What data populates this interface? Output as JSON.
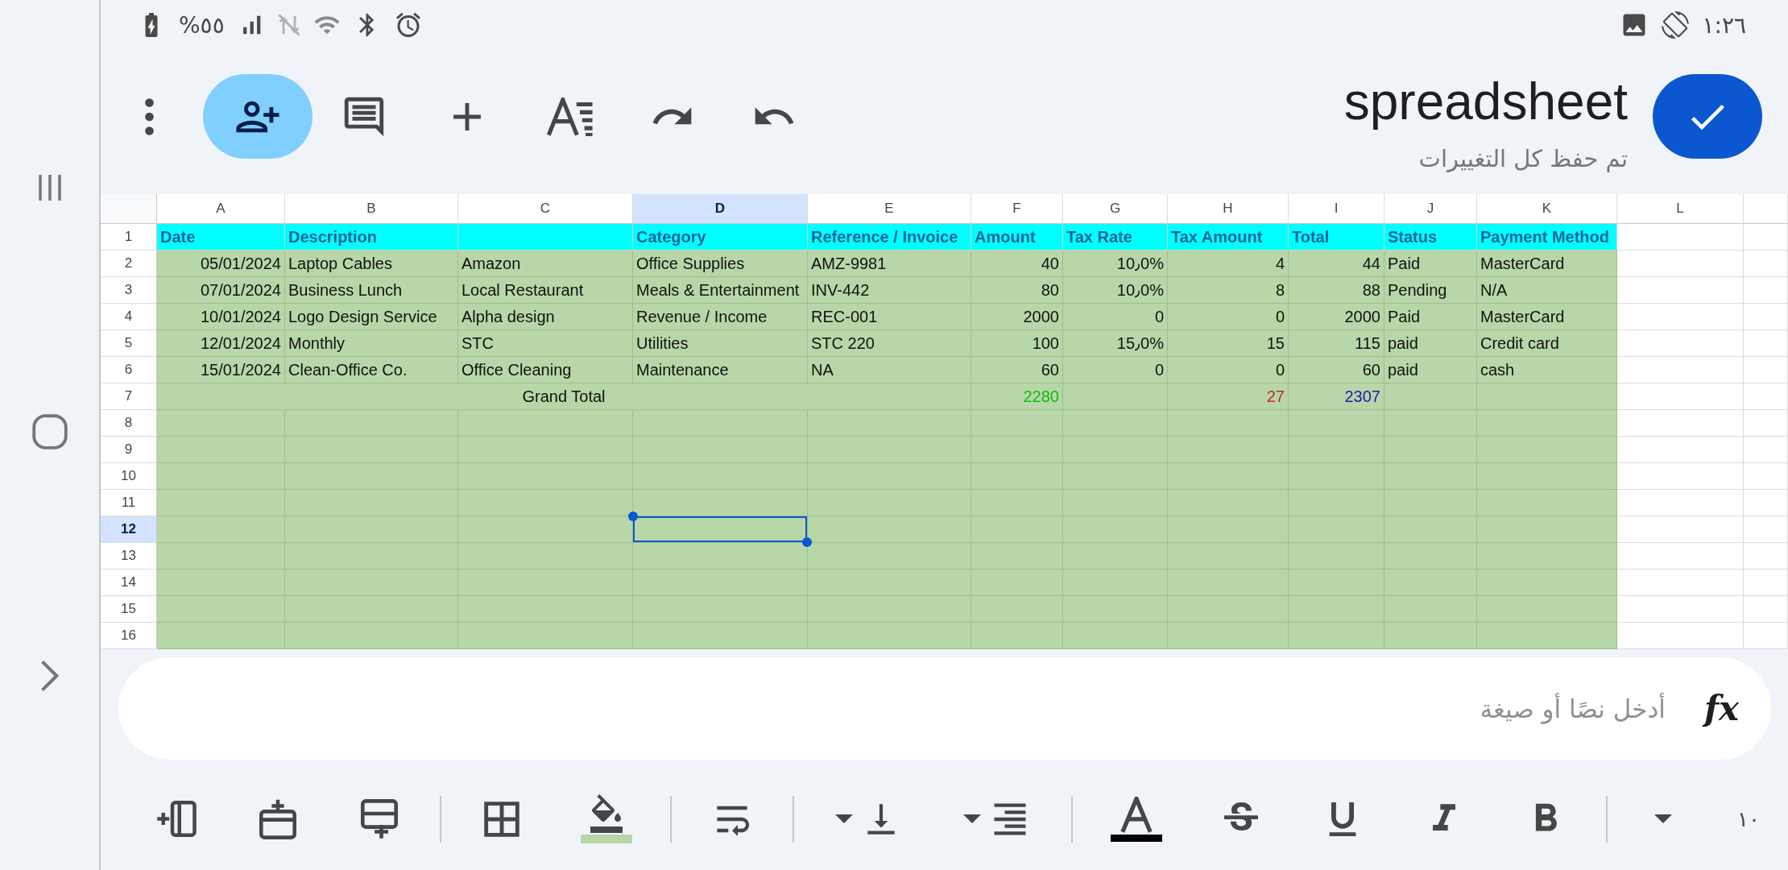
{
  "status_bar": {
    "battery": "%٥٥",
    "time": "١:٢٦"
  },
  "top_bar": {
    "title": "spreadsheet",
    "subtitle": "تم حفظ كل التغييرات"
  },
  "sheet": {
    "columns": [
      "A",
      "B",
      "C",
      "D",
      "E",
      "F",
      "G",
      "H",
      "I",
      "J",
      "K",
      "L"
    ],
    "rows": [
      {
        "number": "1",
        "kind": "header",
        "cells": [
          {
            "kind": "text",
            "text": "Date",
            "selected": false
          },
          {
            "kind": "text",
            "text": "Description",
            "selected": false
          },
          {
            "kind": "empty",
            "selected": false
          },
          {
            "kind": "text",
            "text": "Category",
            "selected": false
          },
          {
            "kind": "text",
            "text": "Reference / Invoice",
            "selected": false
          },
          {
            "kind": "text",
            "text": "Amount",
            "selected": false
          },
          {
            "kind": "text",
            "text": "Tax Rate",
            "selected": false
          },
          {
            "kind": "text",
            "text": "Tax Amount",
            "selected": false
          },
          {
            "kind": "text",
            "text": "Total",
            "selected": false
          },
          {
            "kind": "text",
            "text": "Status",
            "selected": false
          },
          {
            "kind": "text",
            "text": "Payment Method",
            "selected": false
          }
        ]
      },
      {
        "number": "2",
        "kind": "data",
        "cells": [
          {
            "kind": "number",
            "text": "05/01/2024",
            "selected": false
          },
          {
            "kind": "text",
            "text": "Laptop Cables",
            "selected": false
          },
          {
            "kind": "text",
            "text": "Amazon",
            "selected": false
          },
          {
            "kind": "text",
            "text": "Office Supplies",
            "selected": false
          },
          {
            "kind": "text",
            "text": "AMZ-9981",
            "selected": false
          },
          {
            "kind": "number",
            "text": "40",
            "selected": false
          },
          {
            "kind": "number",
            "text": "10٫0%",
            "selected": false
          },
          {
            "kind": "number",
            "text": "4",
            "selected": false
          },
          {
            "kind": "number",
            "text": "44",
            "selected": false
          },
          {
            "kind": "text",
            "text": "Paid",
            "selected": false
          },
          {
            "kind": "text",
            "text": "MasterCard",
            "selected": false
          }
        ]
      },
      {
        "number": "3",
        "kind": "data",
        "cells": [
          {
            "kind": "number",
            "text": "07/01/2024",
            "selected": false
          },
          {
            "kind": "text",
            "text": "Business Lunch",
            "selected": false
          },
          {
            "kind": "text",
            "text": "Local Restaurant",
            "selected": false
          },
          {
            "kind": "text",
            "text": "Meals & Entertainment",
            "selected": false
          },
          {
            "kind": "text",
            "text": "INV-442",
            "selected": false
          },
          {
            "kind": "number",
            "text": "80",
            "selected": false
          },
          {
            "kind": "number",
            "text": "10٫0%",
            "selected": false
          },
          {
            "kind": "number",
            "text": "8",
            "selected": false
          },
          {
            "kind": "number",
            "text": "88",
            "selected": false
          },
          {
            "kind": "text",
            "text": "Pending",
            "selected": false
          },
          {
            "kind": "text",
            "text": "N/A",
            "selected": false
          }
        ]
      },
      {
        "number": "4",
        "kind": "data",
        "cells": [
          {
            "kind": "number",
            "text": "10/01/2024",
            "selected": false
          },
          {
            "kind": "text",
            "text": "Logo Design Service",
            "selected": false
          },
          {
            "kind": "text",
            "text": "Alpha design",
            "selected": false
          },
          {
            "kind": "text",
            "text": "Revenue / Income",
            "selected": false
          },
          {
            "kind": "text",
            "text": "REC-001",
            "selected": false
          },
          {
            "kind": "number",
            "text": "2000",
            "selected": false
          },
          {
            "kind": "number",
            "text": "0",
            "selected": false
          },
          {
            "kind": "number",
            "text": "0",
            "selected": false
          },
          {
            "kind": "number",
            "text": "2000",
            "selected": false
          },
          {
            "kind": "text",
            "text": "Paid",
            "selected": false
          },
          {
            "kind": "text",
            "text": "MasterCard",
            "selected": false
          }
        ]
      },
      {
        "number": "5",
        "kind": "data",
        "cells": [
          {
            "kind": "number",
            "text": "12/01/2024",
            "selected": false
          },
          {
            "kind": "text",
            "text": "Monthly",
            "selected": false
          },
          {
            "kind": "text",
            "text": "STC",
            "selected": false
          },
          {
            "kind": "text",
            "text": "Utilities",
            "selected": false
          },
          {
            "kind": "text",
            "text": "STC 220",
            "selected": false
          },
          {
            "kind": "number",
            "text": "100",
            "selected": false
          },
          {
            "kind": "number",
            "text": "15٫0%",
            "selected": false
          },
          {
            "kind": "number",
            "text": "15",
            "selected": false
          },
          {
            "kind": "number",
            "text": "115",
            "selected": false
          },
          {
            "kind": "text",
            "text": "paid",
            "selected": false
          },
          {
            "kind": "text",
            "text": "Credit card",
            "selected": false
          }
        ]
      },
      {
        "number": "6",
        "kind": "data",
        "cells": [
          {
            "kind": "number",
            "text": "15/01/2024",
            "selected": false
          },
          {
            "kind": "text",
            "text": "Clean-Office Co.",
            "selected": false
          },
          {
            "kind": "text",
            "text": "Office Cleaning",
            "selected": false
          },
          {
            "kind": "text",
            "text": "Maintenance",
            "selected": false
          },
          {
            "kind": "text",
            "text": "NA",
            "selected": false
          },
          {
            "kind": "number",
            "text": "60",
            "selected": false
          },
          {
            "kind": "number",
            "text": "0",
            "selected": false
          },
          {
            "kind": "number",
            "text": "0",
            "selected": false
          },
          {
            "kind": "number",
            "text": "60",
            "selected": false
          },
          {
            "kind": "text",
            "text": "paid",
            "selected": false
          },
          {
            "kind": "text",
            "text": "cash",
            "selected": false
          }
        ]
      },
      {
        "number": "7",
        "kind": "data",
        "cells": [
          {
            "kind": "merged",
            "text": "Grand Total",
            "selected": false
          },
          {
            "kind": "covered"
          },
          {
            "kind": "covered"
          },
          {
            "kind": "covered"
          },
          {
            "kind": "covered"
          },
          {
            "kind": "number",
            "text": "2280",
            "color": "#14b814",
            "selected": false
          },
          {
            "kind": "empty",
            "selected": false
          },
          {
            "kind": "number",
            "text": "27",
            "color": "#c62a1e",
            "selected": false
          },
          {
            "kind": "number",
            "text": "2307",
            "color": "#1c1ca8",
            "selected": false
          },
          {
            "kind": "empty",
            "selected": false
          },
          {
            "kind": "empty",
            "selected": false
          }
        ]
      },
      {
        "number": "8",
        "kind": "data",
        "cells": [
          {
            "kind": "empty",
            "selected": false
          },
          {
            "kind": "empty",
            "selected": false
          },
          {
            "kind": "empty",
            "selected": false
          },
          {
            "kind": "empty",
            "selected": false
          },
          {
            "kind": "empty",
            "selected": false
          },
          {
            "kind": "empty",
            "selected": false
          },
          {
            "kind": "empty",
            "selected": false
          },
          {
            "kind": "empty",
            "selected": false
          },
          {
            "kind": "empty",
            "selected": false
          },
          {
            "kind": "empty",
            "selected": false
          },
          {
            "kind": "empty",
            "selected": false
          }
        ]
      },
      {
        "number": "9",
        "kind": "data",
        "cells": [
          {
            "kind": "empty",
            "selected": false
          },
          {
            "kind": "empty",
            "selected": false
          },
          {
            "kind": "empty",
            "selected": false
          },
          {
            "kind": "empty",
            "selected": false
          },
          {
            "kind": "empty",
            "selected": false
          },
          {
            "kind": "empty",
            "selected": false
          },
          {
            "kind": "empty",
            "selected": false
          },
          {
            "kind": "empty",
            "selected": false
          },
          {
            "kind": "empty",
            "selected": false
          },
          {
            "kind": "empty",
            "selected": false
          },
          {
            "kind": "empty",
            "selected": false
          }
        ]
      },
      {
        "number": "10",
        "kind": "data",
        "cells": [
          {
            "kind": "empty",
            "selected": false
          },
          {
            "kind": "empty",
            "selected": false
          },
          {
            "kind": "empty",
            "selected": false
          },
          {
            "kind": "empty",
            "selected": false
          },
          {
            "kind": "empty",
            "selected": false
          },
          {
            "kind": "empty",
            "selected": false
          },
          {
            "kind": "empty",
            "selected": false
          },
          {
            "kind": "empty",
            "selected": false
          },
          {
            "kind": "empty",
            "selected": false
          },
          {
            "kind": "empty",
            "selected": false
          },
          {
            "kind": "empty",
            "selected": false
          }
        ]
      },
      {
        "number": "11",
        "kind": "data",
        "cells": [
          {
            "kind": "empty",
            "selected": false
          },
          {
            "kind": "empty",
            "selected": false
          },
          {
            "kind": "empty",
            "selected": false
          },
          {
            "kind": "empty",
            "selected": false
          },
          {
            "kind": "empty",
            "selected": false
          },
          {
            "kind": "empty",
            "selected": false
          },
          {
            "kind": "empty",
            "selected": false
          },
          {
            "kind": "empty",
            "selected": false
          },
          {
            "kind": "empty",
            "selected": false
          },
          {
            "kind": "empty",
            "selected": false
          },
          {
            "kind": "empty",
            "selected": false
          }
        ]
      },
      {
        "number": "12",
        "kind": "data",
        "cells": [
          {
            "kind": "empty",
            "selected": false
          },
          {
            "kind": "empty",
            "selected": false
          },
          {
            "kind": "empty",
            "selected": false
          },
          {
            "kind": "empty",
            "selected": true
          },
          {
            "kind": "empty",
            "selected": false
          },
          {
            "kind": "empty",
            "selected": false
          },
          {
            "kind": "empty",
            "selected": false
          },
          {
            "kind": "empty",
            "selected": false
          },
          {
            "kind": "empty",
            "selected": false
          },
          {
            "kind": "empty",
            "selected": false
          },
          {
            "kind": "empty",
            "selected": false
          }
        ]
      },
      {
        "number": "13",
        "kind": "data",
        "cells": [
          {
            "kind": "empty",
            "selected": false
          },
          {
            "kind": "empty",
            "selected": false
          },
          {
            "kind": "empty",
            "selected": false
          },
          {
            "kind": "empty",
            "selected": false
          },
          {
            "kind": "empty",
            "selected": false
          },
          {
            "kind": "empty",
            "selected": false
          },
          {
            "kind": "empty",
            "selected": false
          },
          {
            "kind": "empty",
            "selected": false
          },
          {
            "kind": "empty",
            "selected": false
          },
          {
            "kind": "empty",
            "selected": false
          },
          {
            "kind": "empty",
            "selected": false
          }
        ]
      },
      {
        "number": "14",
        "kind": "data",
        "cells": [
          {
            "kind": "empty",
            "selected": false
          },
          {
            "kind": "empty",
            "selected": false
          },
          {
            "kind": "empty",
            "selected": false
          },
          {
            "kind": "empty",
            "selected": false
          },
          {
            "kind": "empty",
            "selected": false
          },
          {
            "kind": "empty",
            "selected": false
          },
          {
            "kind": "empty",
            "selected": false
          },
          {
            "kind": "empty",
            "selected": false
          },
          {
            "kind": "empty",
            "selected": false
          },
          {
            "kind": "empty",
            "selected": false
          },
          {
            "kind": "empty",
            "selected": false
          }
        ]
      },
      {
        "number": "15",
        "kind": "data",
        "cells": [
          {
            "kind": "empty",
            "selected": false
          },
          {
            "kind": "empty",
            "selected": false
          },
          {
            "kind": "empty",
            "selected": false
          },
          {
            "kind": "empty",
            "selected": false
          },
          {
            "kind": "empty",
            "selected": false
          },
          {
            "kind": "empty",
            "selected": false
          },
          {
            "kind": "empty",
            "selected": false
          },
          {
            "kind": "empty",
            "selected": false
          },
          {
            "kind": "empty",
            "selected": false
          },
          {
            "kind": "empty",
            "selected": false
          },
          {
            "kind": "empty",
            "selected": false
          }
        ]
      },
      {
        "number": "16",
        "kind": "data",
        "cells": [
          {
            "kind": "empty",
            "selected": false
          },
          {
            "kind": "empty",
            "selected": false
          },
          {
            "kind": "empty",
            "selected": false
          },
          {
            "kind": "empty",
            "selected": false
          },
          {
            "kind": "empty",
            "selected": false
          },
          {
            "kind": "empty",
            "selected": false
          },
          {
            "kind": "empty",
            "selected": false
          },
          {
            "kind": "empty",
            "selected": false
          },
          {
            "kind": "empty",
            "selected": false
          },
          {
            "kind": "empty",
            "selected": false
          },
          {
            "kind": "empty",
            "selected": false
          }
        ]
      }
    ]
  },
  "formula_bar": {
    "icon": "fx",
    "placeholder": "أدخل نصًا أو صيغة"
  },
  "format_toolbar": {
    "font_size": "١٠"
  }
}
